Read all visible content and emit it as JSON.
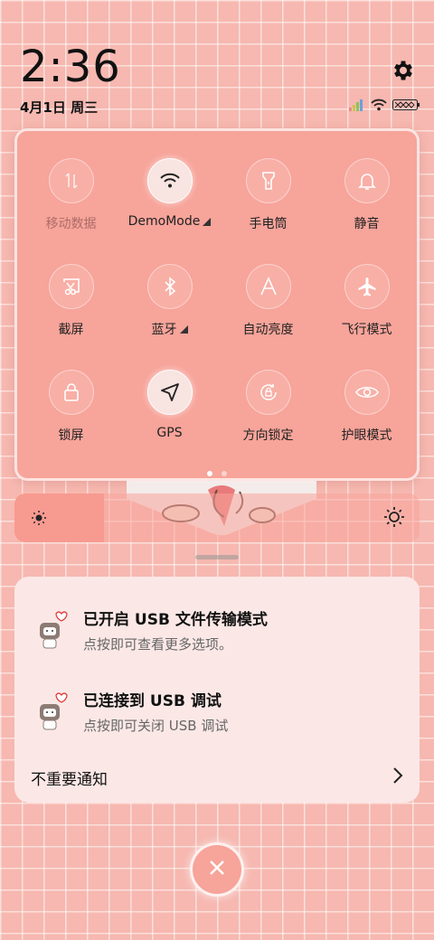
{
  "status": {
    "time": "2:36",
    "date": "4月1日 周三"
  },
  "icons": {
    "settings": "gear-icon",
    "signal": "signal-icon",
    "wifi": "wifi-icon",
    "battery": "battery-icon"
  },
  "toggles": [
    {
      "label": "移动数据",
      "icon": "mobile-data-icon",
      "active": false,
      "dim": true
    },
    {
      "label": "DemoMode",
      "icon": "wifi-icon",
      "active": true,
      "more": true
    },
    {
      "label": "手电筒",
      "icon": "flashlight-icon",
      "active": false
    },
    {
      "label": "静音",
      "icon": "bell-icon",
      "active": false
    },
    {
      "label": "截屏",
      "icon": "screenshot-icon",
      "active": false
    },
    {
      "label": "蓝牙",
      "icon": "bluetooth-icon",
      "active": false,
      "more": true
    },
    {
      "label": "自动亮度",
      "icon": "auto-brightness-icon",
      "active": false
    },
    {
      "label": "飞行模式",
      "icon": "airplane-icon",
      "active": false
    },
    {
      "label": "锁屏",
      "icon": "lock-icon",
      "active": false
    },
    {
      "label": "GPS",
      "icon": "location-arrow-icon",
      "active": true
    },
    {
      "label": "方向锁定",
      "icon": "rotation-lock-icon",
      "active": false
    },
    {
      "label": "护眼模式",
      "icon": "eye-icon",
      "active": false
    }
  ],
  "page_indicator": {
    "current": 1,
    "total": 2
  },
  "brightness": {
    "level": 0.22
  },
  "notifications": [
    {
      "title": "已开启 USB 文件传输模式",
      "body": "点按即可查看更多选项。"
    },
    {
      "title": "已连接到 USB 调试",
      "body": "点按即可关闭 USB 调试"
    }
  ],
  "less_important_label": "不重要通知",
  "clear_button_icon": "close-icon",
  "colors": {
    "accent": "#f7a49a",
    "background": "#f6b8b0",
    "card": "#fbe8e6"
  }
}
